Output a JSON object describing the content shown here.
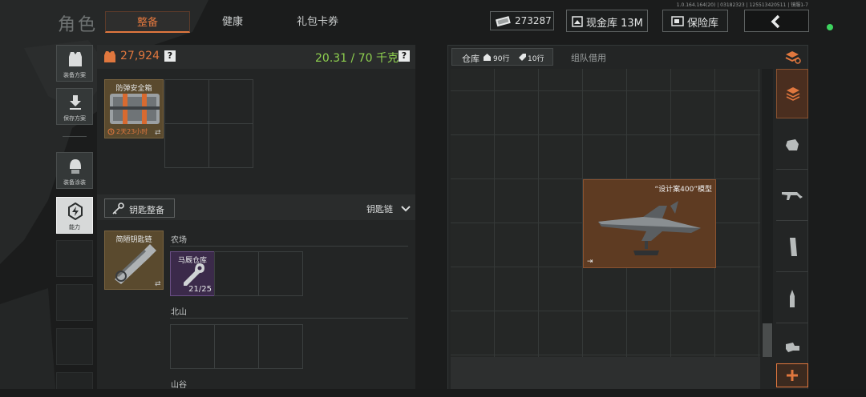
{
  "version": "1.0.164.164(20) | 03182323 | 125513420511 | 镜服1-7",
  "header": {
    "title": "角色",
    "tabs": [
      {
        "label": "整备",
        "active": true
      },
      {
        "label": "健康",
        "active": false
      },
      {
        "label": "礼包卡券",
        "active": false
      }
    ],
    "currency_value": "273287",
    "cash_warehouse_label": "现金库 13M",
    "insurance_label": "保险库",
    "status_color": "#3dd35f"
  },
  "sidebar": {
    "items": [
      {
        "label": "装备方案",
        "icon": "vest-icon"
      },
      {
        "label": "保存方案",
        "icon": "download-icon"
      },
      {
        "label": "装备涂装",
        "icon": "helmet-icon"
      },
      {
        "label": "能力",
        "icon": "ability-icon"
      }
    ]
  },
  "loadout": {
    "value": "27,924",
    "weight": "20.31 / 70 千克",
    "help": "?",
    "safe_box": {
      "name": "防弹安全箱",
      "timer": "2天23小时"
    },
    "key_section": {
      "title": "钥匙整备",
      "dropdown": "钥匙链"
    },
    "keychain": {
      "name": "简陋钥匙链"
    },
    "locations": [
      {
        "name": "农场",
        "key": {
          "name": "马厩仓库",
          "uses": "21/25"
        }
      },
      {
        "name": "北山"
      },
      {
        "name": "山谷"
      }
    ]
  },
  "warehouse": {
    "tab_label": "仓库",
    "rows_90": "90行",
    "rows_10": "10行",
    "team_tab": "组队借用",
    "item": {
      "name": "“设计案400”模型"
    }
  },
  "colors": {
    "accent": "#e0773e",
    "weight_green": "#8fd14f",
    "value_orange": "#e0773e"
  }
}
